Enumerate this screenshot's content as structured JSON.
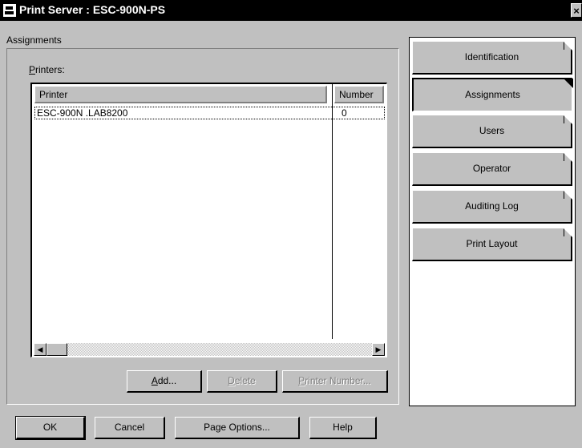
{
  "window": {
    "title": "Print Server : ESC-900N-PS",
    "close_label": "×"
  },
  "assignments": {
    "group_label": "Assignments",
    "printers_label_prefix": "P",
    "printers_label_rest": "rinters:",
    "columns": [
      "Printer",
      "Number"
    ],
    "rows": [
      {
        "printer": "ESC-900N .LAB8200",
        "number": "0"
      }
    ],
    "scroll_left_glyph": "◀",
    "scroll_right_glyph": "▶"
  },
  "list_buttons": {
    "add_prefix": "A",
    "add_rest": "dd...",
    "delete_prefix": "D",
    "delete_rest": "elete",
    "printer_number_prefix": "P",
    "printer_number_rest": "rinter Number..."
  },
  "tabs": [
    {
      "label": "Identification",
      "active": false
    },
    {
      "label": "Assignments",
      "active": true
    },
    {
      "label": "Users",
      "active": false
    },
    {
      "label": "Operator",
      "active": false
    },
    {
      "label": "Auditing Log",
      "active": false
    },
    {
      "label": "Print Layout",
      "active": false
    }
  ],
  "footer_buttons": {
    "ok": "OK",
    "cancel": "Cancel",
    "page_options": "Page Options...",
    "help": "Help"
  }
}
